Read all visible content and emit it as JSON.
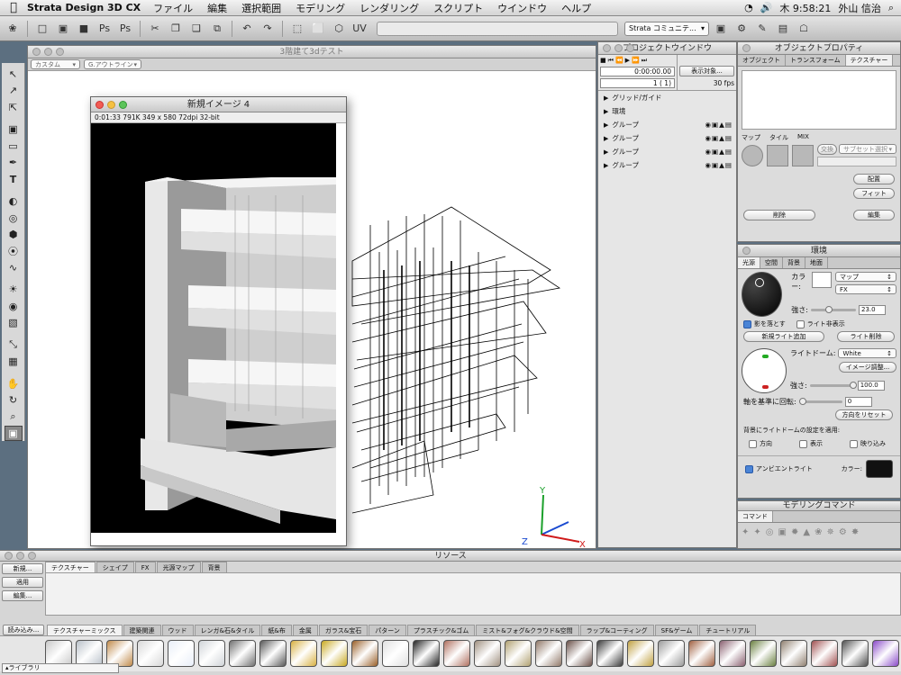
{
  "menubar": {
    "app": "Strata Design 3D CX",
    "items": [
      "ファイル",
      "編集",
      "選択範囲",
      "モデリング",
      "レンダリング",
      "スクリプト",
      "ウインドウ",
      "ヘルプ"
    ],
    "clock": "木 9:58:21",
    "user": "外山 信治"
  },
  "toolbar": {
    "community": "Strata コミュニテ..."
  },
  "viewport": {
    "title": "3階建て3dテスト",
    "view_combo": "カスタム",
    "mode_combo": "G.アウトライン"
  },
  "image_window": {
    "title": "新規イメージ 4",
    "info": "0:01:33   791K   349 x 580   72dpi   32-bit"
  },
  "axes": {
    "x": "X",
    "y": "Y",
    "z": "Z"
  },
  "project": {
    "title": "プロジェクトウインドウ",
    "timecode": "0:00:00.00",
    "frame": "1 ( 1)",
    "display_btn": "表示対象...",
    "fps": "30 fps",
    "items": [
      "グリッド/ガイド",
      "環境",
      "グループ",
      "グループ",
      "グループ",
      "グループ"
    ]
  },
  "objprop": {
    "title": "オブジェクトプロパティ",
    "tabs": [
      "オブジェクト",
      "トランスフォーム",
      "テクスチャー"
    ],
    "map_labels": [
      "マップ",
      "タイル",
      "MIX"
    ],
    "swap_btn": "交換",
    "subset": "サブセット選択",
    "place_btn": "配置",
    "fit_btn": "フィット",
    "delete_btn": "削除",
    "edit_btn": "編集"
  },
  "environment": {
    "title": "環境",
    "tabs": [
      "光源",
      "空間",
      "背景",
      "地面"
    ],
    "color_label": "カラー:",
    "map_select": "マップ",
    "fx_select": "FX",
    "strength_label": "強さ:",
    "strength_value": "23.0",
    "cast_shadow": "影を落とす",
    "hide_light": "ライト非表示",
    "add_light_btn": "新規ライト追加",
    "delete_light_btn": "ライト削除",
    "dome_label": "ライトドーム:",
    "dome_value": "White",
    "image_adjust_btn": "イメージ調整...",
    "dome_strength_label": "強さ:",
    "dome_strength_value": "100.0",
    "rotate_label": "軸を基準に回転:",
    "rotate_value": "0",
    "reset_dir_btn": "方向をリセット",
    "apply_bg_label": "背景にライトドームの設定を適用:",
    "dir_check": "方向",
    "show_check": "表示",
    "reflect_check": "映り込み",
    "ambient_check": "アンビエントライト",
    "ambient_color_label": "カラー:"
  },
  "modeling": {
    "title": "モデリングコマンド",
    "tab": "コマンド"
  },
  "resources": {
    "title": "リソース",
    "new_btn": "新規...",
    "apply_btn": "適用",
    "edit_btn": "編集...",
    "load_btn": "読み込み...",
    "library_btn": "ライブラリ",
    "tabs": [
      "テクスチャー",
      "シェイプ",
      "FX",
      "光源マップ",
      "背景"
    ],
    "lib_tabs": [
      "テクスチャーミックス",
      "建築関連",
      "ウッド",
      "レンガ&石&タイル",
      "紙&布",
      "金属",
      "ガラス&宝石",
      "パターン",
      "プラスチック&ゴム",
      "ミスト&フォグ&クラウド&空間",
      "ラップ&コーティング",
      "SF&ゲーム",
      "チュートリアル"
    ]
  },
  "colors": {
    "swatches": [
      "#c8c8c8",
      "#b8c0c8",
      "#c08a4a",
      "#d8d8d8",
      "#e8eef8",
      "#d0d4d8",
      "#707070",
      "#585858",
      "#d8b040",
      "#c8a820",
      "#9a6028",
      "#e0e0e0",
      "#222222",
      "#b07060",
      "#a09080",
      "#b0a070",
      "#907868",
      "#6a5048",
      "#3a3a3a",
      "#c0a040",
      "#9a9a9a",
      "#a06040",
      "#8a6070",
      "#6a8040",
      "#908070",
      "#a05050",
      "#505050",
      "#8a4ac8"
    ],
    "ambient": "#111111"
  }
}
